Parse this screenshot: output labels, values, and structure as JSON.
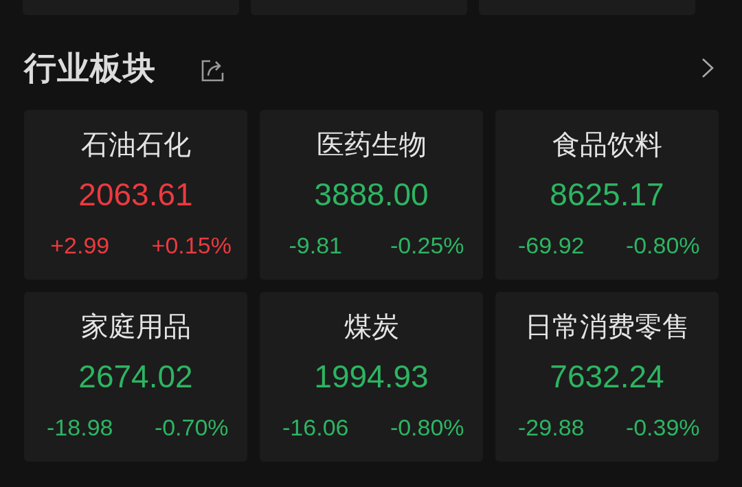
{
  "section": {
    "title": "行业板块"
  },
  "sectors": [
    {
      "name": "石油石化",
      "value": "2063.61",
      "change": "+2.99",
      "percent": "+0.15%",
      "rising": true
    },
    {
      "name": "医药生物",
      "value": "3888.00",
      "change": "-9.81",
      "percent": "-0.25%",
      "rising": false
    },
    {
      "name": "食品饮料",
      "value": "8625.17",
      "change": "-69.92",
      "percent": "-0.80%",
      "rising": false
    },
    {
      "name": "家庭用品",
      "value": "2674.02",
      "change": "-18.98",
      "percent": "-0.70%",
      "rising": false
    },
    {
      "name": "煤炭",
      "value": "1994.93",
      "change": "-16.06",
      "percent": "-0.80%",
      "rising": false
    },
    {
      "name": "日常消费零售",
      "value": "7632.24",
      "change": "-29.88",
      "percent": "-0.39%",
      "rising": false
    }
  ]
}
